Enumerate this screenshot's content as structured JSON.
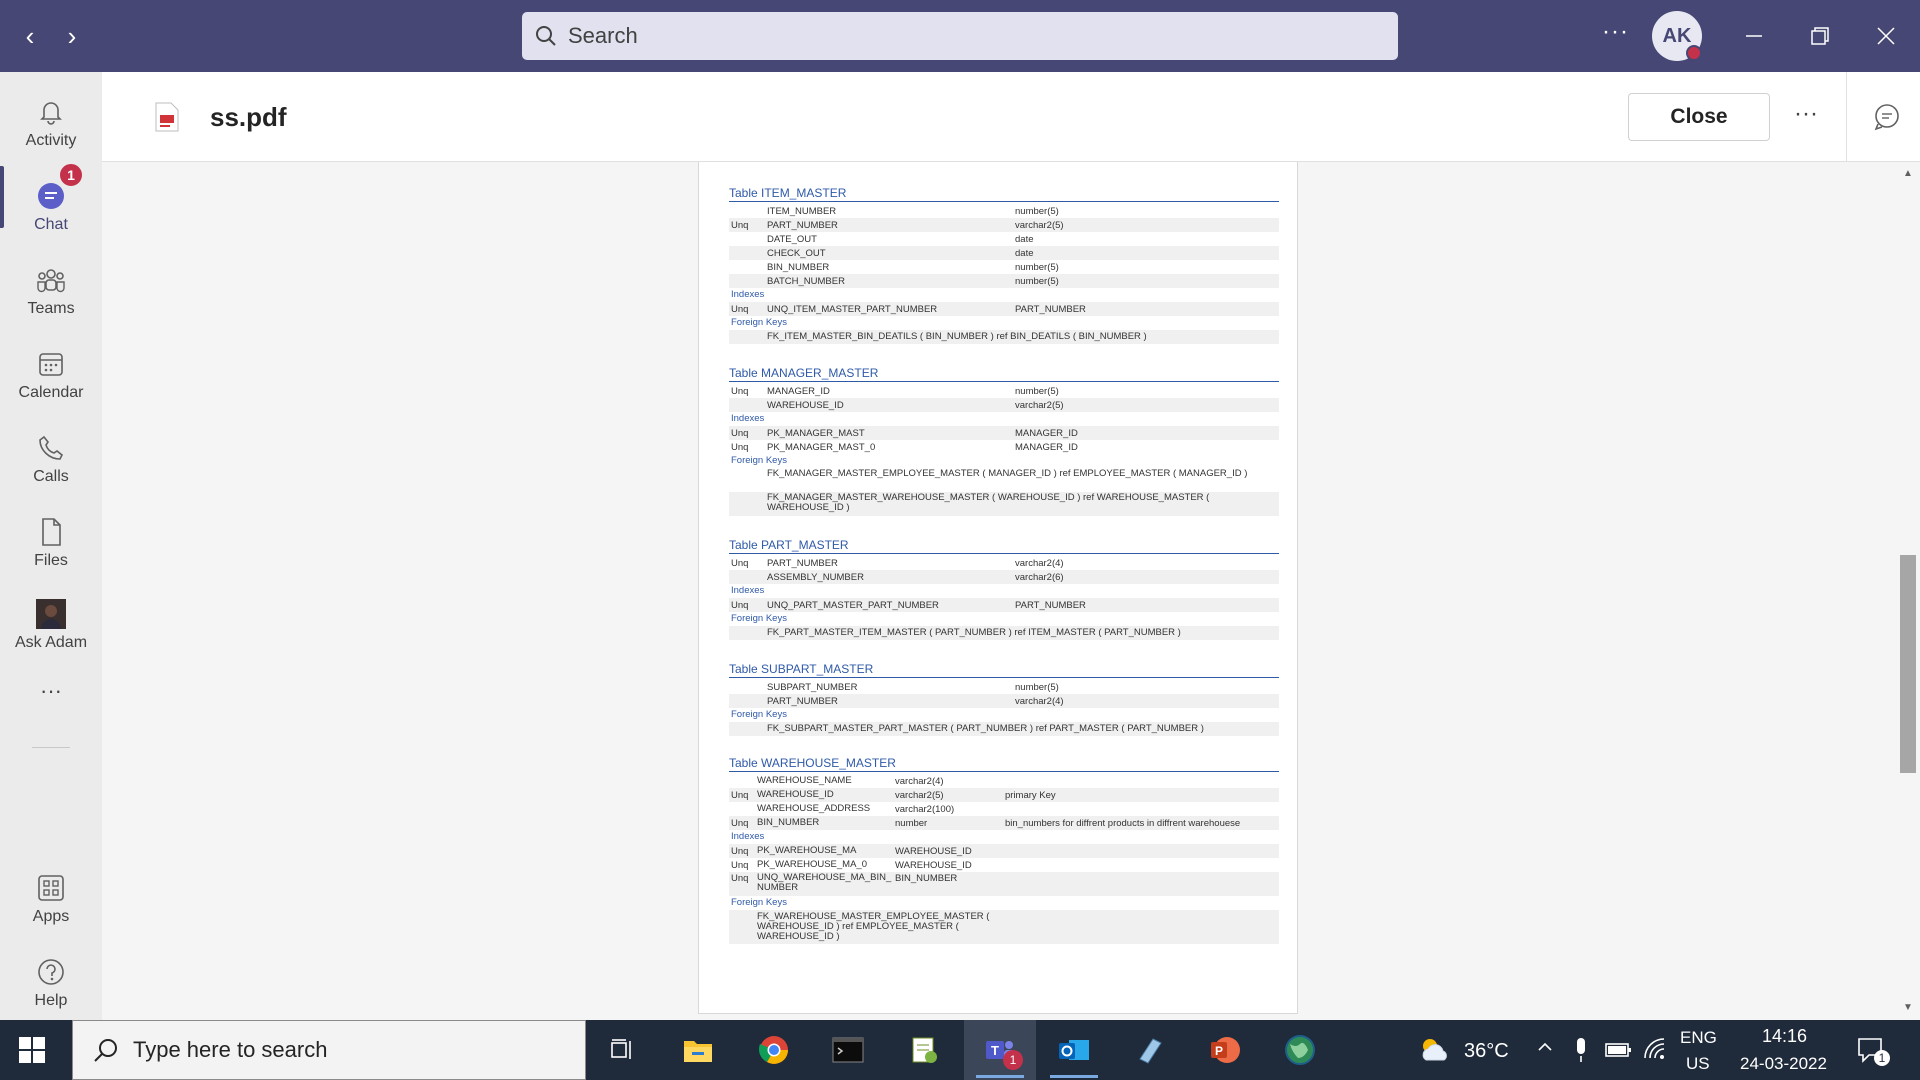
{
  "titlebar": {
    "search_placeholder": "Search",
    "more": "···",
    "avatar_initials": "AK"
  },
  "rail": {
    "items": [
      {
        "label": "Activity"
      },
      {
        "label": "Chat",
        "badge": "1"
      },
      {
        "label": "Teams"
      },
      {
        "label": "Calendar"
      },
      {
        "label": "Calls"
      },
      {
        "label": "Files"
      },
      {
        "label": "Ask Adam"
      }
    ],
    "more": "···",
    "apps": "Apps",
    "help": "Help"
  },
  "file": {
    "name": "ss.pdf",
    "close_label": "Close",
    "more": "···"
  },
  "document": {
    "item_master": {
      "title": "Table ITEM_MASTER",
      "columns": [
        {
          "key": "",
          "name": "ITEM_NUMBER",
          "type": "number(5)"
        },
        {
          "key": "Unq",
          "name": "PART_NUMBER",
          "type": "varchar2(5)"
        },
        {
          "key": "",
          "name": "DATE_OUT",
          "type": "date"
        },
        {
          "key": "",
          "name": "CHECK_OUT",
          "type": "date"
        },
        {
          "key": "",
          "name": "BIN_NUMBER",
          "type": "number(5)"
        },
        {
          "key": "",
          "name": "BATCH_NUMBER",
          "type": "number(5)"
        }
      ],
      "indexes_label": "Indexes",
      "indexes": [
        {
          "key": "Unq",
          "name": "UNQ_ITEM_MASTER_PART_NUMBER",
          "col": "PART_NUMBER"
        }
      ],
      "fk_label": "Foreign Keys",
      "fks": [
        "FK_ITEM_MASTER_BIN_DEATILS ( BIN_NUMBER ) ref BIN_DEATILS ( BIN_NUMBER )"
      ]
    },
    "manager_master": {
      "title": "Table MANAGER_MASTER",
      "columns": [
        {
          "key": "Unq",
          "name": "MANAGER_ID",
          "type": "number(5)"
        },
        {
          "key": "",
          "name": "WAREHOUSE_ID",
          "type": "varchar2(5)"
        }
      ],
      "indexes_label": "Indexes",
      "indexes": [
        {
          "key": "Unq",
          "name": "PK_MANAGER_MAST",
          "col": "MANAGER_ID"
        },
        {
          "key": "Unq",
          "name": "PK_MANAGER_MAST_0",
          "col": "MANAGER_ID"
        }
      ],
      "fk_label": "Foreign Keys",
      "fks": [
        "FK_MANAGER_MASTER_EMPLOYEE_MASTER ( MANAGER_ID ) ref EMPLOYEE_MASTER ( MANAGER_ID )",
        "FK_MANAGER_MASTER_WAREHOUSE_MASTER ( WAREHOUSE_ID ) ref WAREHOUSE_MASTER ( WAREHOUSE_ID )"
      ]
    },
    "part_master": {
      "title": "Table PART_MASTER",
      "columns": [
        {
          "key": "Unq",
          "name": "PART_NUMBER",
          "type": "varchar2(4)"
        },
        {
          "key": "",
          "name": "ASSEMBLY_NUMBER",
          "type": "varchar2(6)"
        }
      ],
      "indexes_label": "Indexes",
      "indexes": [
        {
          "key": "Unq",
          "name": "UNQ_PART_MASTER_PART_NUMBER",
          "col": "PART_NUMBER"
        }
      ],
      "fk_label": "Foreign Keys",
      "fks": [
        "FK_PART_MASTER_ITEM_MASTER ( PART_NUMBER ) ref ITEM_MASTER ( PART_NUMBER )"
      ]
    },
    "subpart_master": {
      "title": "Table SUBPART_MASTER",
      "columns": [
        {
          "key": "",
          "name": "SUBPART_NUMBER",
          "type": "number(5)"
        },
        {
          "key": "",
          "name": "PART_NUMBER",
          "type": "varchar2(4)"
        }
      ],
      "fk_label": "Foreign Keys",
      "fks": [
        "FK_SUBPART_MASTER_PART_MASTER ( PART_NUMBER ) ref PART_MASTER ( PART_NUMBER )"
      ]
    },
    "warehouse_master": {
      "title": "Table WAREHOUSE_MASTER",
      "columns": [
        {
          "key": "",
          "name": "WAREHOUSE_NAME",
          "type": "varchar2(4)",
          "note": ""
        },
        {
          "key": "Unq",
          "name": "WAREHOUSE_ID",
          "type": "varchar2(5)",
          "note": "primary Key"
        },
        {
          "key": "",
          "name": "WAREHOUSE_ADDRESS",
          "type": "varchar2(100)",
          "note": ""
        },
        {
          "key": "Unq",
          "name": "BIN_NUMBER",
          "type": "number",
          "note": "bin_numbers for diffrent products in diffrent warehouese"
        }
      ],
      "indexes_label": "Indexes",
      "indexes": [
        {
          "key": "Unq",
          "name": "PK_WAREHOUSE_MA",
          "col": "WAREHOUSE_ID"
        },
        {
          "key": "Unq",
          "name": "PK_WAREHOUSE_MA_0",
          "col": "WAREHOUSE_ID"
        },
        {
          "key": "Unq",
          "name": "UNQ_WAREHOUSE_MA_BIN_NUMBER",
          "col": "BIN_NUMBER"
        }
      ],
      "fk_label": "Foreign Keys",
      "fks": [
        "FK_WAREHOUSE_MASTER_EMPLOYEE_MASTER ( WAREHOUSE_ID ) ref EMPLOYEE_MASTER ( WAREHOUSE_ID )"
      ]
    }
  },
  "taskbar": {
    "search_placeholder": "Type here to search",
    "temperature": "36°C",
    "lang_top": "ENG",
    "lang_bottom": "US",
    "time": "14:16",
    "date": "24-03-2022",
    "teams_badge": "1",
    "notif_count": "1"
  }
}
